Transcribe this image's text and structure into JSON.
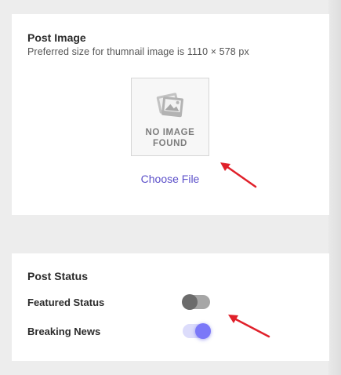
{
  "post_image": {
    "title": "Post Image",
    "subtitle": "Preferred size for thumnail image is 1110 × 578 px",
    "placeholder_line1": "NO IMAGE",
    "placeholder_line2": "FOUND",
    "choose_file_label": "Choose File"
  },
  "post_status": {
    "title": "Post Status",
    "featured_label": "Featured Status",
    "featured_on": false,
    "breaking_label": "Breaking News",
    "breaking_on": true
  },
  "colors": {
    "accent": "#7b78f8",
    "link": "#5b4fc9",
    "annotation_arrow": "#e0202a"
  },
  "icons": [
    "image-placeholder-icon",
    "annotation-arrow-icon"
  ]
}
